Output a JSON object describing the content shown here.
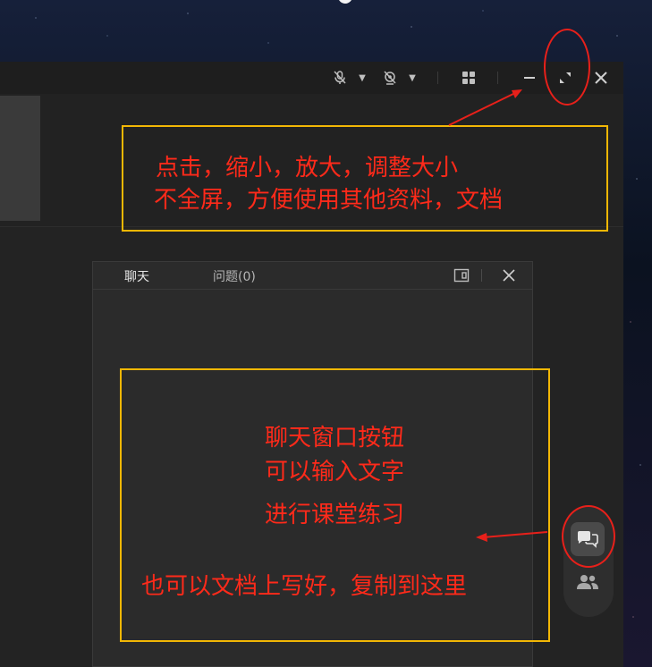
{
  "titlebar": {
    "icons": [
      "mic-muted-icon",
      "camera-muted-icon",
      "grid-layout-icon",
      "minimize-icon",
      "restore-icon",
      "close-icon"
    ]
  },
  "chat": {
    "tab_chat": "聊天",
    "tab_questions": "问题(0)",
    "icons": [
      "popout-icon",
      "close-icon"
    ]
  },
  "dock": {
    "icons": [
      "chat-bubbles-icon",
      "participants-icon"
    ]
  },
  "annotations": {
    "top": {
      "line1": "点击，缩小，放大，调整大小",
      "line2": "不全屏，方便使用其他资料，文档"
    },
    "bottom": {
      "line1": "聊天窗口按钮",
      "line2": "可以输入文字",
      "line3": "进行课堂练习",
      "line4": "也可以文档上写好，复制到这里"
    }
  },
  "colors": {
    "annotation_text": "#ff2a1a",
    "box_border": "#f2b705",
    "circle": "#e8201a"
  }
}
